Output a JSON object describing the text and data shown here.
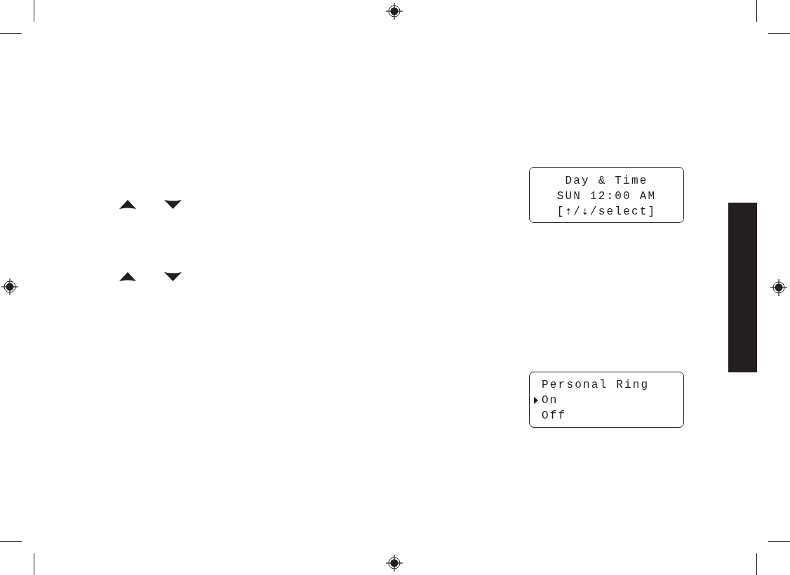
{
  "displays": [
    {
      "kind": "text",
      "lines": [
        "Day & Time",
        "SUN 12:00 AM",
        "[⇡/⇣/select]"
      ]
    },
    {
      "kind": "menu",
      "title": "Personal Ring",
      "options": [
        {
          "label": "On",
          "selected": true
        },
        {
          "label": "Off",
          "selected": false
        }
      ]
    }
  ]
}
